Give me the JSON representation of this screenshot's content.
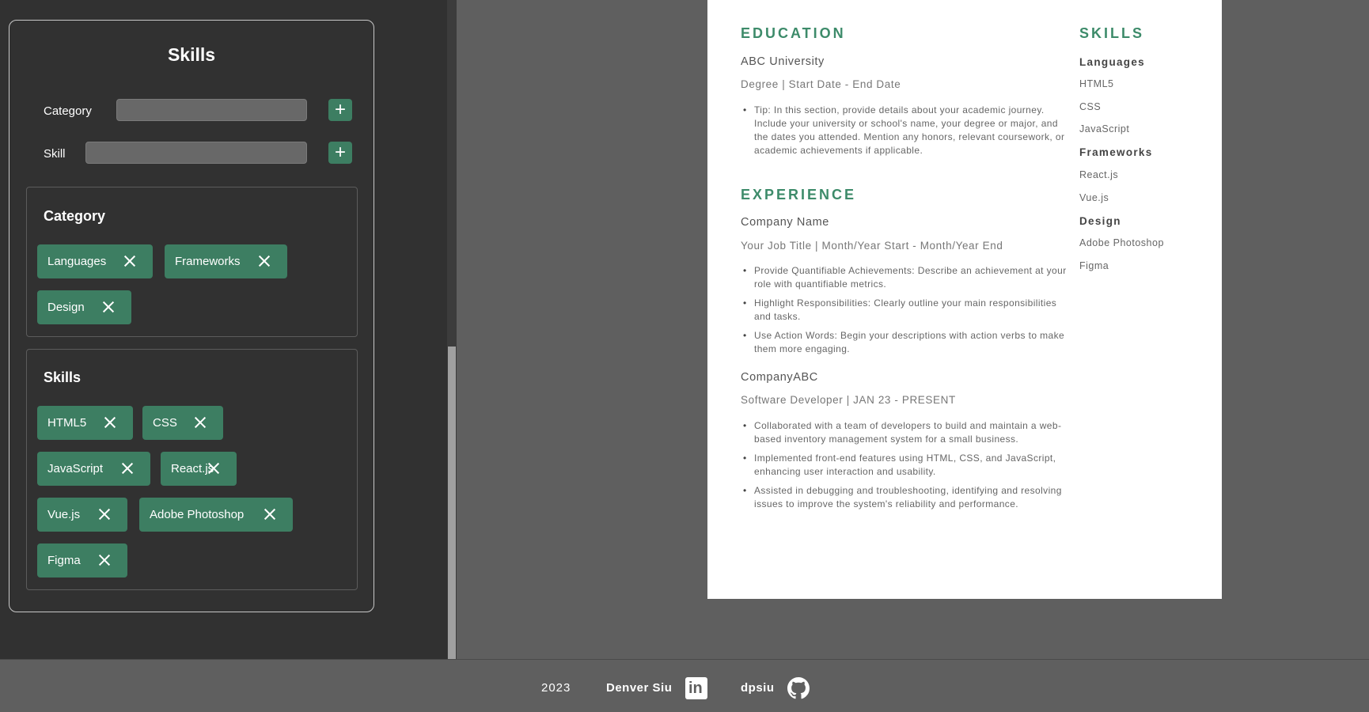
{
  "editor": {
    "panel_title": "Skills",
    "category_label": "Category",
    "category_value": "",
    "skill_label": "Skill",
    "skill_value": "",
    "add_symbol": "+",
    "category_box_title": "Category",
    "categories": [
      "Languages",
      "Frameworks",
      "Design"
    ],
    "skills_box_title": "Skills",
    "skills": [
      "HTML5",
      "CSS",
      "JavaScript",
      "React.js",
      "Vue.js",
      "Adobe Photoshop",
      "Figma"
    ]
  },
  "resume": {
    "education": {
      "title": "EDUCATION",
      "school": "ABC University",
      "degree_line": "Degree |  Start Date - End Date",
      "bullets": [
        "Tip: In this section, provide details about your academic journey. Include your university or school's name, your degree or major, and the dates you attended. Mention any honors, relevant coursework, or academic achievements if applicable."
      ]
    },
    "experience": {
      "title": "EXPERIENCE",
      "jobs": [
        {
          "company": "Company Name",
          "role_line": "Your Job Title |  Month/Year Start - Month/Year End",
          "bullets": [
            "Provide Quantifiable Achievements: Describe an achievement at your role with quantifiable metrics.",
            "Highlight Responsibilities: Clearly outline your main responsibilities and tasks.",
            "Use Action Words: Begin your descriptions with action verbs to make them more engaging."
          ]
        },
        {
          "company": "CompanyABC",
          "role_line": "Software Developer |  JAN 23 - PRESENT",
          "bullets": [
            "Collaborated with a team of developers to build and maintain a web-based inventory management system for a small business.",
            "Implemented front-end features using HTML, CSS, and JavaScript, enhancing user interaction and usability.",
            "Assisted in debugging and troubleshooting, identifying and resolving issues to improve the system's reliability and performance."
          ]
        }
      ]
    },
    "skills": {
      "title": "SKILLS",
      "groups": [
        {
          "name": "Languages",
          "items": [
            "HTML5",
            "CSS",
            "JavaScript"
          ]
        },
        {
          "name": "Frameworks",
          "items": [
            "React.js",
            "Vue.js"
          ]
        },
        {
          "name": "Design",
          "items": [
            "Adobe Photoshop",
            "Figma"
          ]
        }
      ]
    }
  },
  "footer": {
    "year": "2023",
    "name": "Denver Siu",
    "linkedin_icon": "linkedin-icon",
    "username": "dpsiu",
    "github_icon": "github-icon"
  },
  "colors": {
    "accent": "#3d7e62",
    "heading_green": "#3d8b6a",
    "panel_bg": "#313131",
    "page_bg": "#5f5f5f"
  }
}
